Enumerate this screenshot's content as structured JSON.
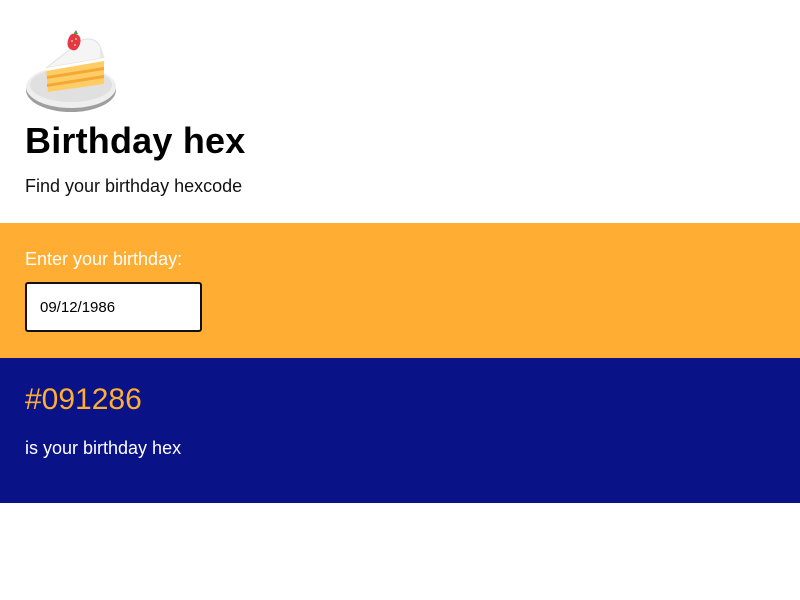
{
  "header": {
    "icon": "birthday-cake-icon",
    "title": "Birthday hex",
    "subtitle": "Find your birthday hexcode"
  },
  "input_section": {
    "label": "Enter your birthday:",
    "value": "09/12/1986",
    "background_color": "#ffad33"
  },
  "result_section": {
    "hex": "#091286",
    "caption": "is your birthday hex",
    "background_color": "#091286",
    "hex_color": "#ffad33"
  }
}
